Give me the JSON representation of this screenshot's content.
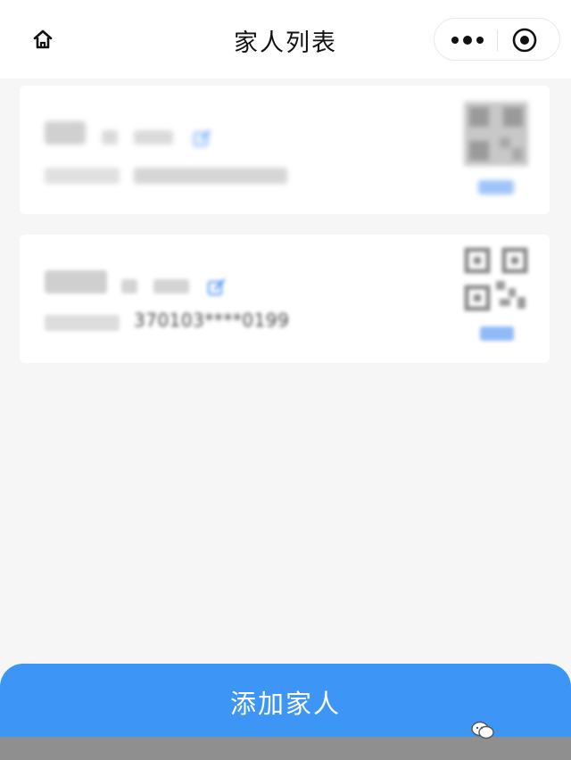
{
  "header": {
    "title": "家人列表",
    "home_icon": "home-icon",
    "more_icon": "more-dots-icon",
    "close_icon": "capsule-close-icon"
  },
  "members": [
    {
      "name": "",
      "gender": "",
      "age": "",
      "id_label": "",
      "id_number": "",
      "qr_link": ""
    },
    {
      "name": "",
      "gender": "",
      "age": "",
      "id_label": "",
      "id_number": "370103****0199",
      "qr_link": ""
    }
  ],
  "footer": {
    "add_button_label": "添加家人",
    "watermark_text": "",
    "watermark_icon": "wechat-icon"
  },
  "colors": {
    "accent": "#3d96f5",
    "link": "#3d8bf5",
    "background": "#f6f6f6",
    "card": "#ffffff"
  }
}
